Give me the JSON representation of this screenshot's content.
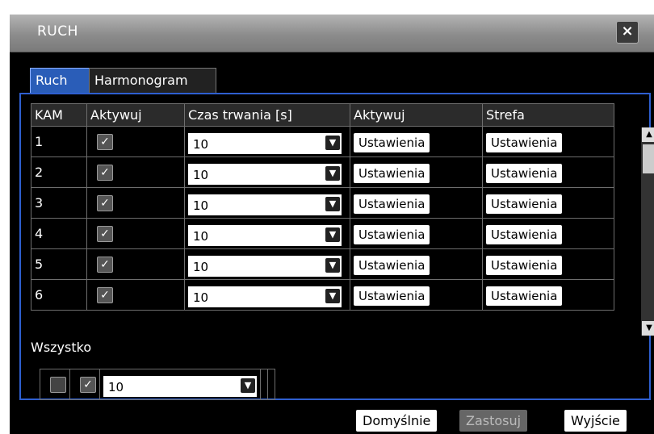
{
  "window": {
    "title": "RUCH",
    "close_label": "×"
  },
  "tabs": [
    {
      "label": "Ruch",
      "active": true
    },
    {
      "label": "Harmonogram",
      "active": false
    }
  ],
  "table": {
    "headers": [
      "KAM",
      "Aktywuj",
      "Czas trwania [s]",
      "Aktywuj",
      "Strefa"
    ],
    "rows": [
      {
        "cam": "1",
        "checked": true,
        "duration": "10",
        "activate_btn": "Ustawienia",
        "zone_btn": "Ustawienia"
      },
      {
        "cam": "2",
        "checked": true,
        "duration": "10",
        "activate_btn": "Ustawienia",
        "zone_btn": "Ustawienia"
      },
      {
        "cam": "3",
        "checked": true,
        "duration": "10",
        "activate_btn": "Ustawienia",
        "zone_btn": "Ustawienia"
      },
      {
        "cam": "4",
        "checked": true,
        "duration": "10",
        "activate_btn": "Ustawienia",
        "zone_btn": "Ustawienia"
      },
      {
        "cam": "5",
        "checked": true,
        "duration": "10",
        "activate_btn": "Ustawienia",
        "zone_btn": "Ustawienia"
      },
      {
        "cam": "6",
        "checked": true,
        "duration": "10",
        "activate_btn": "Ustawienia",
        "zone_btn": "Ustawienia"
      }
    ]
  },
  "all": {
    "label": "Wszystko",
    "checked": true,
    "duration": "10"
  },
  "buttons": {
    "default": "Domyślnie",
    "apply": "Zastosuj",
    "exit": "Wyjście"
  },
  "icons": {
    "check": "check-icon",
    "arrow": "chevron-down-icon",
    "close": "close-icon"
  }
}
